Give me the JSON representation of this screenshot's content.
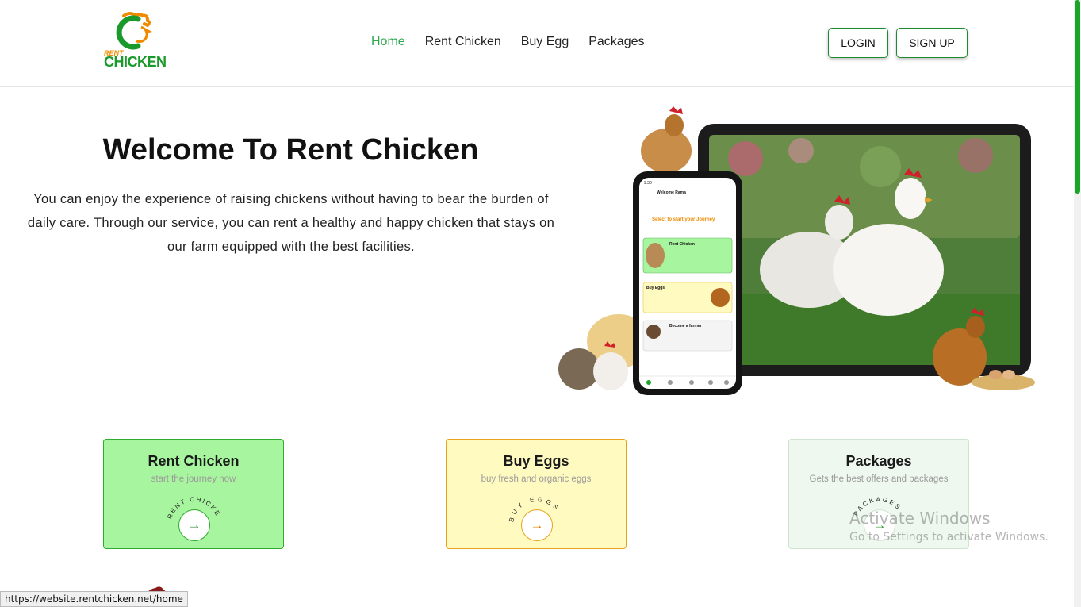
{
  "logo": {
    "top_text": "RENT",
    "main_text": "CHICKEN"
  },
  "nav": {
    "items": [
      {
        "label": "Home",
        "active": true
      },
      {
        "label": "Rent Chicken",
        "active": false
      },
      {
        "label": "Buy Egg",
        "active": false
      },
      {
        "label": "Packages",
        "active": false
      }
    ]
  },
  "auth": {
    "login_label": "LOGIN",
    "signup_label": "SIGN UP"
  },
  "hero": {
    "title": "Welcome To Rent Chicken",
    "text": "You can enjoy the experience of raising chickens without having to bear the burden of daily care. Through our service, you can rent a healthy and happy chicken that stays on our farm equipped with the best facilities."
  },
  "phone": {
    "time": "9:30",
    "greeting": "Welcome Rama",
    "prompt": "Select to start your Journey",
    "items": [
      {
        "label": "Rent Chicken"
      },
      {
        "label": "Buy Eggs"
      },
      {
        "label": "Become a farmer"
      }
    ]
  },
  "cards": [
    {
      "title": "Rent Chicken",
      "subtitle": "start the journey now",
      "ring_text": "RENT CHICKE",
      "icon": "arrow-right-icon"
    },
    {
      "title": "Buy Eggs",
      "subtitle": "buy fresh and organic eggs",
      "ring_text": "BUY EGGS",
      "icon": "arrow-right-icon"
    },
    {
      "title": "Packages",
      "subtitle": "Gets the best offers and packages",
      "ring_text": "PACKAGES",
      "icon": "arrow-right-icon"
    }
  ],
  "watermark": {
    "title": "Activate Windows",
    "subtitle": "Go to Settings to activate Windows."
  },
  "status_bar": {
    "url": "https://website.rentchicken.net/home"
  },
  "colors": {
    "brand_green": "#1a9a2a",
    "brand_orange": "#f08a00",
    "nav_active": "#2fa84f"
  }
}
